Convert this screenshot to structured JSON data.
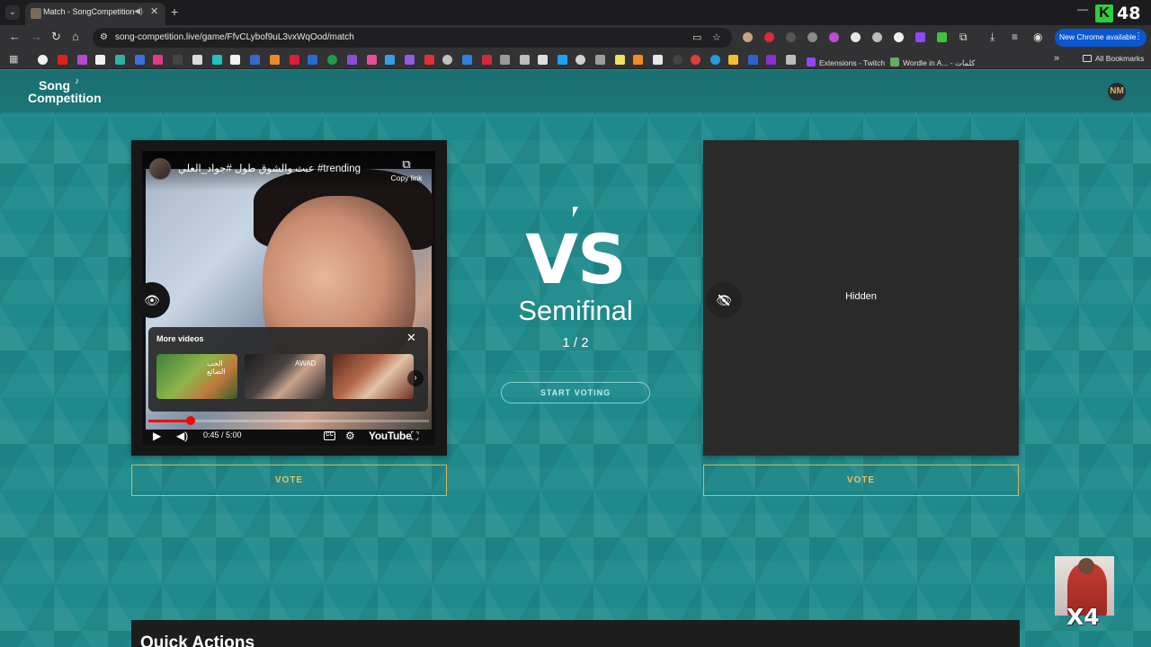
{
  "browser": {
    "tab_title": "Match - SongCompetition",
    "url": "song-competition.live/game/FfvCLybof9uL3vxWqOod/match",
    "new_chrome_label": "New Chrome available",
    "ext_count": "48",
    "ext_letter": "K",
    "bookmarks": [
      {
        "label": "Extensions - Twitch",
        "color": "#9146ff"
      },
      {
        "label": "Wordle in A... - كلمات",
        "color": "#6aaa64"
      }
    ],
    "all_bookmarks_label": "All Bookmarks"
  },
  "site": {
    "logo_line1": "Song",
    "logo_line2": "Competition",
    "avatar_text": "NM"
  },
  "left_song": {
    "video_title": "عبث والشوق طول #جواد_العلي #trending",
    "copy_link_label": "Copy link",
    "more_videos_title": "More videos",
    "time": "0:45 / 5:00",
    "progress_fraction": 0.15,
    "youtube_label": "YouTube",
    "thumb1_text": "الحب الضائع",
    "thumb2_text": "AWAD",
    "vote_label": "VOTE"
  },
  "center": {
    "vs_label": "VS",
    "round_name": "Semifinal",
    "round_progress": "1 / 2",
    "start_voting_label": "START VOTING"
  },
  "right_song": {
    "hidden_label": "Hidden",
    "vote_label": "VOTE"
  },
  "quick_actions": {
    "title": "Quick Actions"
  },
  "overlay": {
    "multiplier": "X4"
  },
  "colors": {
    "page_teal": "#1e8a8b",
    "vote_gold": "#e3c65c",
    "chrome_blue": "#0b57d0",
    "progress_red": "#ff0000"
  }
}
